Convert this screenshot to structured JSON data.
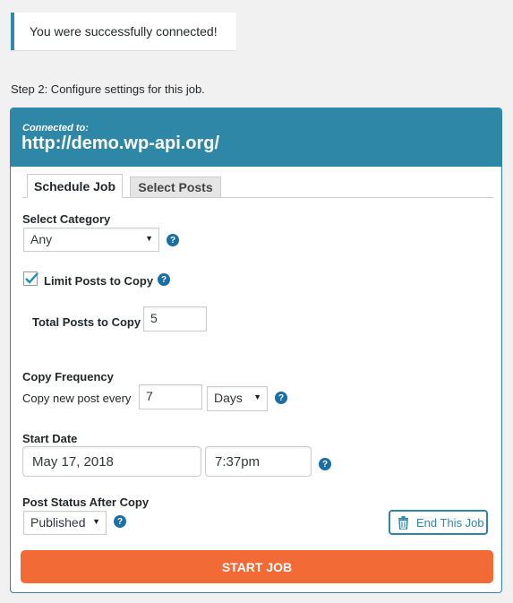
{
  "notice": {
    "message": "You were successfully connected!"
  },
  "step": {
    "text": "Step 2: Configure settings for this job."
  },
  "header": {
    "connected_label": "Connected to:",
    "url": "http://demo.wp-api.org/"
  },
  "tabs": [
    {
      "label": "Schedule Job",
      "active": true
    },
    {
      "label": "Select Posts",
      "active": false
    }
  ],
  "category": {
    "label": "Select Category",
    "selected": "Any"
  },
  "limit": {
    "label": "Limit Posts to Copy",
    "checked": true
  },
  "total": {
    "label": "Total Posts to Copy",
    "value": "5"
  },
  "frequency": {
    "label": "Copy Frequency",
    "prefix": "Copy new post every",
    "value": "7",
    "unit": "Days"
  },
  "start_date": {
    "label": "Start Date",
    "date": "May 17, 2018",
    "time": "7:37pm"
  },
  "post_status": {
    "label": "Post Status After Copy",
    "selected": "Published"
  },
  "buttons": {
    "end_job": "End This Job",
    "start_job": "START JOB"
  },
  "colors": {
    "accent": "#2e87a7",
    "start_button": "#f26a35",
    "help_icon": "#1a6fa6"
  }
}
